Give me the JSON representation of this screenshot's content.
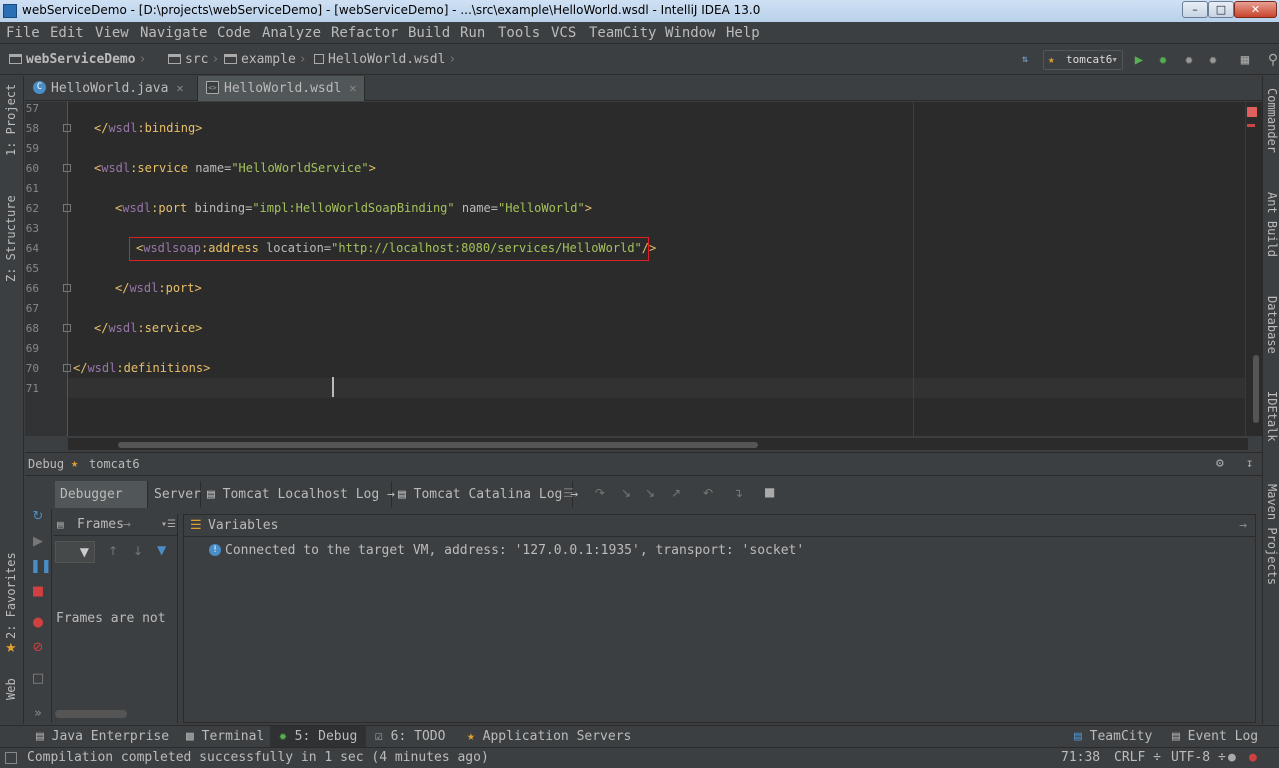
{
  "window": {
    "title": "webServiceDemo - [D:\\projects\\webServiceDemo] - [webServiceDemo] - ...\\src\\example\\HelloWorld.wsdl - IntelliJ IDEA 13.0"
  },
  "menu": [
    "File",
    "Edit",
    "View",
    "Navigate",
    "Code",
    "Analyze",
    "Refactor",
    "Build",
    "Run",
    "Tools",
    "VCS",
    "TeamCity",
    "Window",
    "Help"
  ],
  "breadcrumb": {
    "project": "webServiceDemo",
    "src": "src",
    "pkg": "example",
    "file": "HelloWorld.wsdl"
  },
  "toolbar": {
    "run_config": "tomcat6"
  },
  "editor_tabs": [
    {
      "label": "HelloWorld.java"
    },
    {
      "label": "HelloWorld.wsdl"
    }
  ],
  "code": {
    "lines": [
      "57",
      "58",
      "59",
      "60",
      "61",
      "62",
      "63",
      "64",
      "65",
      "66",
      "67",
      "68",
      "69",
      "70",
      "71"
    ],
    "l58_ns": "wsdl",
    "l58_tag": "binding",
    "l60_ns": "wsdl",
    "l60_tag": "service",
    "l60_attr": "name",
    "l60_val": "\"HelloWorldService\"",
    "l62_ns": "wsdl",
    "l62_tag": "port",
    "l62_attr1": "binding",
    "l62_val1": "\"impl:HelloWorldSoapBinding\"",
    "l62_attr2": "name",
    "l62_val2": "\"HelloWorld\"",
    "l64_ns": "wsdlsoap",
    "l64_tag": "address",
    "l64_attr": "location",
    "l64_val": "\"http://localhost:8080/services/HelloWorld\"",
    "l66_ns": "wsdl",
    "l66_tag": "port",
    "l68_ns": "wsdl",
    "l68_tag": "service",
    "l70_ns": "wsdl",
    "l70_tag": "definitions"
  },
  "left_tools": {
    "project": "1: Project",
    "structure": "Z: Structure",
    "favorites": "2: Favorites",
    "web": "Web"
  },
  "right_tools": {
    "commander": "Commander",
    "ant": "Ant Build",
    "database": "Database",
    "idetalk": "IDEtalk",
    "maven": "Maven Projects"
  },
  "debug": {
    "label": "Debug",
    "config": "tomcat6",
    "tabs": [
      "Debugger",
      "Server",
      "Tomcat Localhost Log",
      "Tomcat Catalina Log"
    ],
    "frames_title": "Frames",
    "frames_msg": "Frames are not",
    "variables_title": "Variables",
    "message": "Connected to the target VM, address: '127.0.0.1:1935', transport: 'socket'"
  },
  "bottom_tabs": {
    "java_ee": "Java Enterprise",
    "terminal": "Terminal",
    "debug": "5: Debug",
    "todo": "6: TODO",
    "app_servers": "Application Servers",
    "teamcity": "TeamCity",
    "event_log": "Event Log"
  },
  "status": {
    "message": "Compilation completed successfully in 1 sec (4 minutes ago)",
    "position": "71:38",
    "line_sep": "CRLF ÷",
    "encoding": "UTF-8 ÷"
  }
}
